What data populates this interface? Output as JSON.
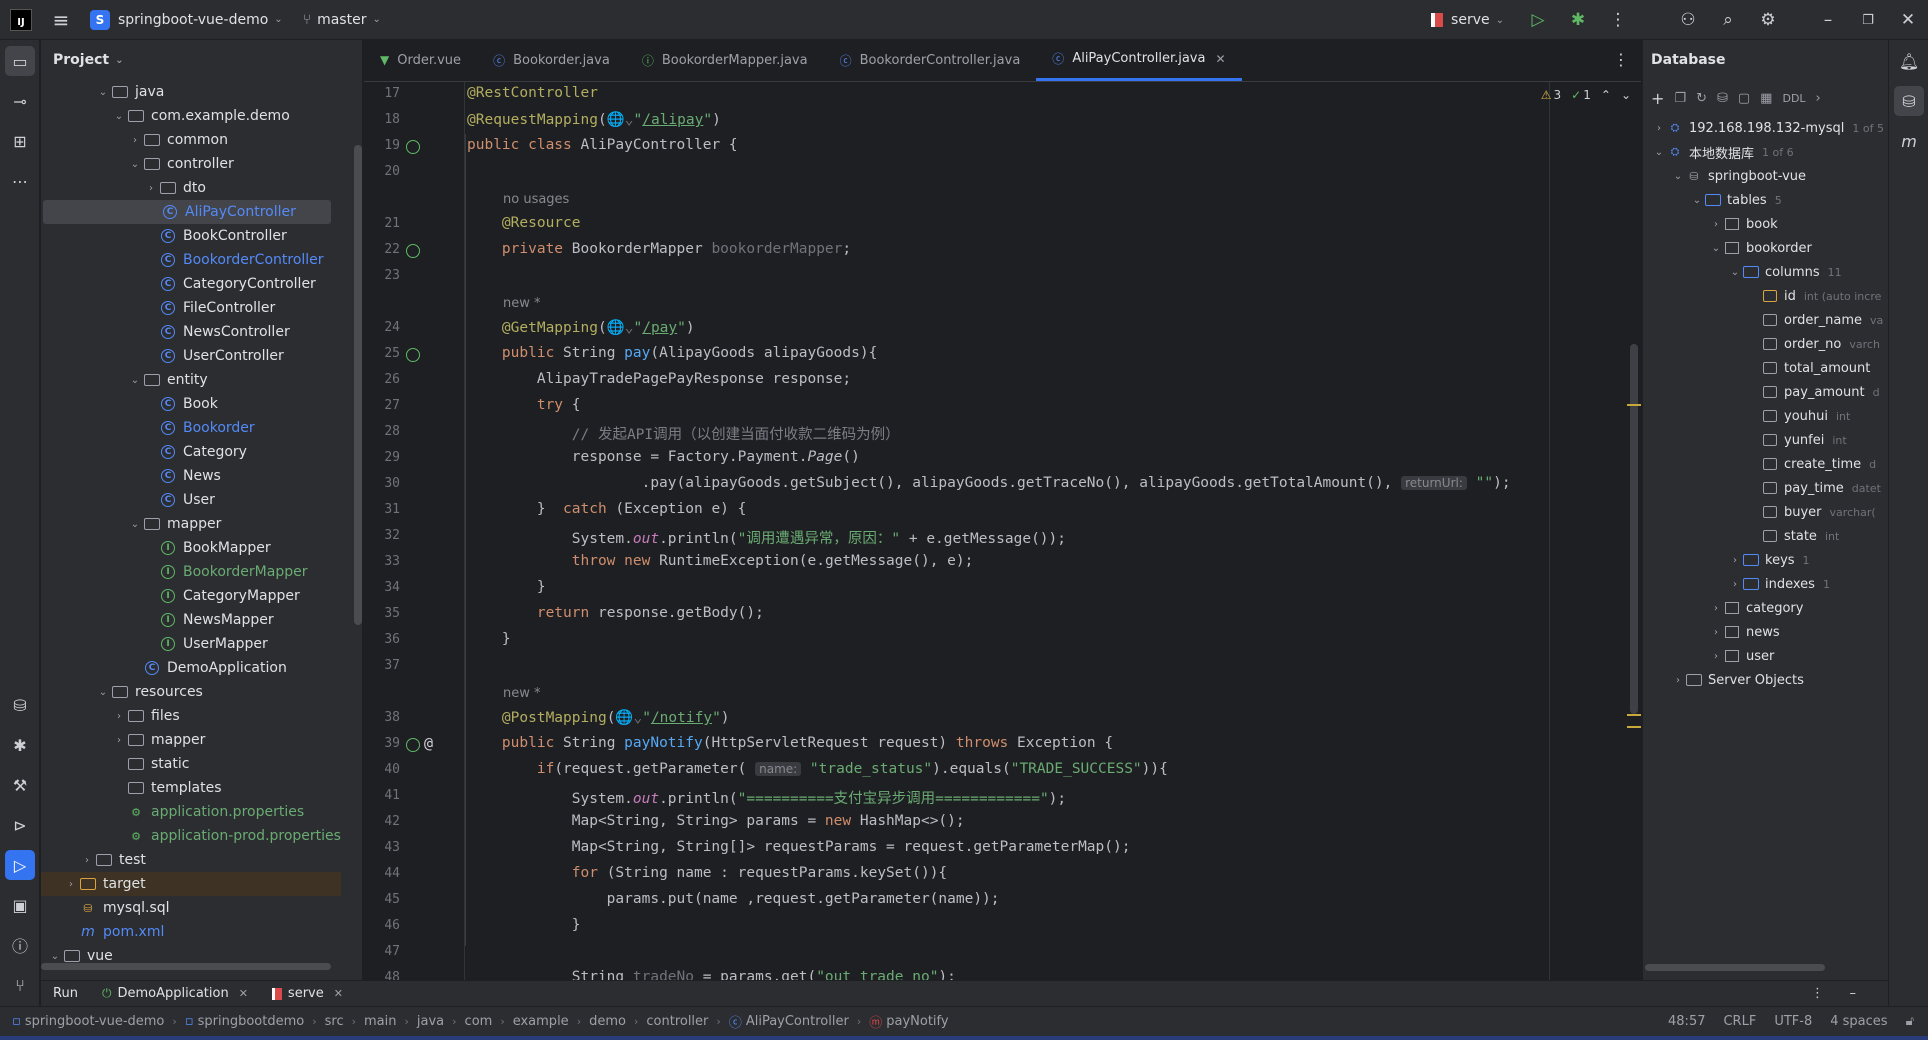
{
  "titlebar": {
    "project": "springboot-vue-demo",
    "project_initial": "S",
    "branch": "master",
    "run_config": "serve"
  },
  "project_panel": {
    "title": "Project",
    "items": [
      {
        "label": "java",
        "kind": "folder",
        "open": true
      },
      {
        "label": "com.example.demo",
        "kind": "package",
        "open": true
      },
      {
        "label": "common",
        "kind": "package",
        "open": false
      },
      {
        "label": "controller",
        "kind": "package",
        "open": true
      },
      {
        "label": "dto",
        "kind": "package",
        "open": false
      },
      {
        "label": "AliPayController",
        "kind": "class",
        "state": "selected"
      },
      {
        "label": "BookController",
        "kind": "class"
      },
      {
        "label": "BookorderController",
        "kind": "class",
        "state": "modified"
      },
      {
        "label": "CategoryController",
        "kind": "class"
      },
      {
        "label": "FileController",
        "kind": "class"
      },
      {
        "label": "NewsController",
        "kind": "class"
      },
      {
        "label": "UserController",
        "kind": "class"
      },
      {
        "label": "entity",
        "kind": "package",
        "open": true
      },
      {
        "label": "Book",
        "kind": "class"
      },
      {
        "label": "Bookorder",
        "kind": "class",
        "state": "modified"
      },
      {
        "label": "Category",
        "kind": "class"
      },
      {
        "label": "News",
        "kind": "class"
      },
      {
        "label": "User",
        "kind": "class"
      },
      {
        "label": "mapper",
        "kind": "package",
        "open": true
      },
      {
        "label": "BookMapper",
        "kind": "interface"
      },
      {
        "label": "BookorderMapper",
        "kind": "interface",
        "state": "modified"
      },
      {
        "label": "CategoryMapper",
        "kind": "interface"
      },
      {
        "label": "NewsMapper",
        "kind": "interface"
      },
      {
        "label": "UserMapper",
        "kind": "interface"
      },
      {
        "label": "DemoApplication",
        "kind": "class"
      },
      {
        "label": "resources",
        "kind": "folder",
        "open": true
      },
      {
        "label": "files",
        "kind": "folder",
        "open": false
      },
      {
        "label": "mapper",
        "kind": "folder",
        "open": false
      },
      {
        "label": "static",
        "kind": "folder"
      },
      {
        "label": "templates",
        "kind": "folder"
      },
      {
        "label": "application.properties",
        "kind": "props",
        "state": "modified"
      },
      {
        "label": "application-prod.properties",
        "kind": "props",
        "state": "modified"
      },
      {
        "label": "test",
        "kind": "folder",
        "open": false
      },
      {
        "label": "target",
        "kind": "folder",
        "open": false,
        "state": "excluded"
      },
      {
        "label": "mysql.sql",
        "kind": "sql"
      },
      {
        "label": "pom.xml",
        "kind": "maven",
        "state": "modified"
      },
      {
        "label": "vue",
        "kind": "folder",
        "open": true
      }
    ]
  },
  "editor": {
    "tabs": [
      {
        "label": "Order.vue",
        "icon": "vue-icon",
        "active": false
      },
      {
        "label": "Bookorder.java",
        "icon": "class-icon",
        "active": false
      },
      {
        "label": "BookorderMapper.java",
        "icon": "interface-icon",
        "active": false
      },
      {
        "label": "BookorderController.java",
        "icon": "class-icon",
        "active": false
      },
      {
        "label": "AliPayController.java",
        "icon": "class-icon",
        "active": true
      }
    ],
    "inspections": {
      "warnings": "3",
      "ok": "1"
    },
    "lines": [
      {
        "n": "17",
        "html": "<span class='an'>@RestController</span>"
      },
      {
        "n": "18",
        "html": "<span class='an'>@RequestMapping</span>(<span class='gray'>🌐⌄</span><span class='st'>\"<u>/alipay</u>\"</span>)"
      },
      {
        "n": "19",
        "html": "<span class='kw'>public class</span> AliPayController {"
      },
      {
        "n": "20",
        "html": ""
      },
      {
        "n": "",
        "hint": "no usages",
        "indent": 1
      },
      {
        "n": "21",
        "html": "    <span class='an'>@Resource</span>"
      },
      {
        "n": "22",
        "html": "    <span class='kw'>private</span> BookorderMapper <span class='gray'>bookorderMapper</span>;"
      },
      {
        "n": "23",
        "html": ""
      },
      {
        "n": "",
        "hint": "new *",
        "indent": 1
      },
      {
        "n": "24",
        "html": "    <span class='an'>@GetMapping</span>(<span class='gray'>🌐⌄</span><span class='st'>\"<u>/pay</u>\"</span>)"
      },
      {
        "n": "25",
        "html": "    <span class='kw'>public</span> String <span class='fn'>pay</span>(AlipayGoods alipayGoods){"
      },
      {
        "n": "26",
        "html": "        AlipayTradePagePayResponse response;"
      },
      {
        "n": "27",
        "html": "        <span class='kw'>try</span> {"
      },
      {
        "n": "28",
        "html": "            <span class='cm'>// 发起API调用（以创建当面付收款二维码为例）</span>"
      },
      {
        "n": "29",
        "html": "            response = Factory.Payment.<i>Page</i>()"
      },
      {
        "n": "30",
        "html": "                    .pay(alipayGoods.getSubject(), alipayGoods.getTraceNo(), alipayGoods.getTotalAmount(), <span class='ph-i'>returnUrl:</span> <span class='st'>\"\"</span>);"
      },
      {
        "n": "31",
        "html": "        }  <span class='kw'>catch</span> (Exception e) {"
      },
      {
        "n": "32",
        "html": "            System.<span class='fld'><i>out</i></span>.println(<span class='st'>\"调用遭遇异常，原因：\"</span> + e.getMessage());"
      },
      {
        "n": "33",
        "html": "            <span class='kw'>throw new</span> RuntimeException(e.getMessage(), e);"
      },
      {
        "n": "34",
        "html": "        }"
      },
      {
        "n": "35",
        "html": "        <span class='kw'>return</span> response.getBody();"
      },
      {
        "n": "36",
        "html": "    }"
      },
      {
        "n": "37",
        "html": ""
      },
      {
        "n": "",
        "hint": "new *",
        "indent": 1
      },
      {
        "n": "38",
        "html": "    <span class='an'>@PostMapping</span>(<span class='gray'>🌐⌄</span><span class='st'>\"<u>/notify</u>\"</span>)"
      },
      {
        "n": "39",
        "html": "    <span class='kw'>public</span> String <span class='fn'>payNotify</span>(HttpServletRequest request) <span class='kw'>throws</span> Exception {"
      },
      {
        "n": "40",
        "html": "        <span class='kw'>if</span>(request.getParameter( <span class='ph-i'>name:</span> <span class='st'>\"trade_status\"</span>).equals(<span class='st'>\"TRADE_SUCCESS\"</span>)){"
      },
      {
        "n": "41",
        "html": "            System.<span class='fld'><i>out</i></span>.println(<span class='st'>\"==========支付宝异步调用============\"</span>);"
      },
      {
        "n": "42",
        "html": "            Map&lt;String, String&gt; params = <span class='kw'>new</span> HashMap&lt;&gt;();"
      },
      {
        "n": "43",
        "html": "            Map&lt;String, String[]&gt; requestParams = request.getParameterMap();"
      },
      {
        "n": "44",
        "html": "            <span class='kw'>for</span> (String name : requestParams.keySet()){"
      },
      {
        "n": "45",
        "html": "                params.put(name ,request.getParameter(name));"
      },
      {
        "n": "46",
        "html": "            }"
      },
      {
        "n": "47",
        "html": ""
      },
      {
        "n": "48",
        "html": "            String <span class='gray'>tradeNo</span> = params.get(<span class='st'>\"out_trade_no\"</span>);"
      }
    ]
  },
  "database": {
    "title": "Database",
    "toolbar_ddl": "DDL",
    "items": [
      {
        "label": "192.168.198.132-mysql",
        "meta": "1 of 5",
        "kind": "datasource",
        "depth": 0,
        "open": false
      },
      {
        "label": "本地数据库",
        "meta": "1 of 6",
        "kind": "datasource",
        "depth": 0,
        "open": true
      },
      {
        "label": "springboot-vue",
        "meta": "",
        "kind": "schema",
        "depth": 1,
        "open": true
      },
      {
        "label": "tables",
        "meta": "5",
        "kind": "folder",
        "depth": 2,
        "open": true
      },
      {
        "label": "book",
        "meta": "",
        "kind": "table",
        "depth": 3,
        "open": false
      },
      {
        "label": "bookorder",
        "meta": "",
        "kind": "table",
        "depth": 3,
        "open": true
      },
      {
        "label": "columns",
        "meta": "11",
        "kind": "folder",
        "depth": 4,
        "open": true
      },
      {
        "label": "id",
        "meta": "int (auto incre",
        "kind": "key",
        "depth": 5
      },
      {
        "label": "order_name",
        "meta": "va",
        "kind": "column",
        "depth": 5
      },
      {
        "label": "order_no",
        "meta": "varch",
        "kind": "column",
        "depth": 5
      },
      {
        "label": "total_amount",
        "meta": "",
        "kind": "column",
        "depth": 5
      },
      {
        "label": "pay_amount",
        "meta": "d",
        "kind": "column",
        "depth": 5
      },
      {
        "label": "youhui",
        "meta": "int",
        "kind": "column",
        "depth": 5
      },
      {
        "label": "yunfei",
        "meta": "int",
        "kind": "column",
        "depth": 5
      },
      {
        "label": "create_time",
        "meta": "d",
        "kind": "column",
        "depth": 5
      },
      {
        "label": "pay_time",
        "meta": "datet",
        "kind": "column",
        "depth": 5
      },
      {
        "label": "buyer",
        "meta": "varchar(",
        "kind": "column",
        "depth": 5
      },
      {
        "label": "state",
        "meta": "int",
        "kind": "column",
        "depth": 5
      },
      {
        "label": "keys",
        "meta": "1",
        "kind": "folder",
        "depth": 4,
        "open": false
      },
      {
        "label": "indexes",
        "meta": "1",
        "kind": "folder",
        "depth": 4,
        "open": false
      },
      {
        "label": "category",
        "meta": "",
        "kind": "table",
        "depth": 3,
        "open": false
      },
      {
        "label": "news",
        "meta": "",
        "kind": "table",
        "depth": 3,
        "open": false
      },
      {
        "label": "user",
        "meta": "",
        "kind": "table",
        "depth": 3,
        "open": false
      },
      {
        "label": "Server Objects",
        "meta": "",
        "kind": "folder",
        "depth": 1,
        "open": false
      }
    ]
  },
  "run_bar": {
    "title": "Run",
    "tabs": [
      "DemoApplication",
      "serve"
    ]
  },
  "status": {
    "breadcrumb": [
      "springboot-vue-demo",
      "springbootdemo",
      "src",
      "main",
      "java",
      "com",
      "example",
      "demo",
      "controller",
      "AliPayController",
      "payNotify"
    ],
    "position": "48:57",
    "line_sep": "CRLF",
    "encoding": "UTF-8",
    "indent": "4 spaces"
  }
}
